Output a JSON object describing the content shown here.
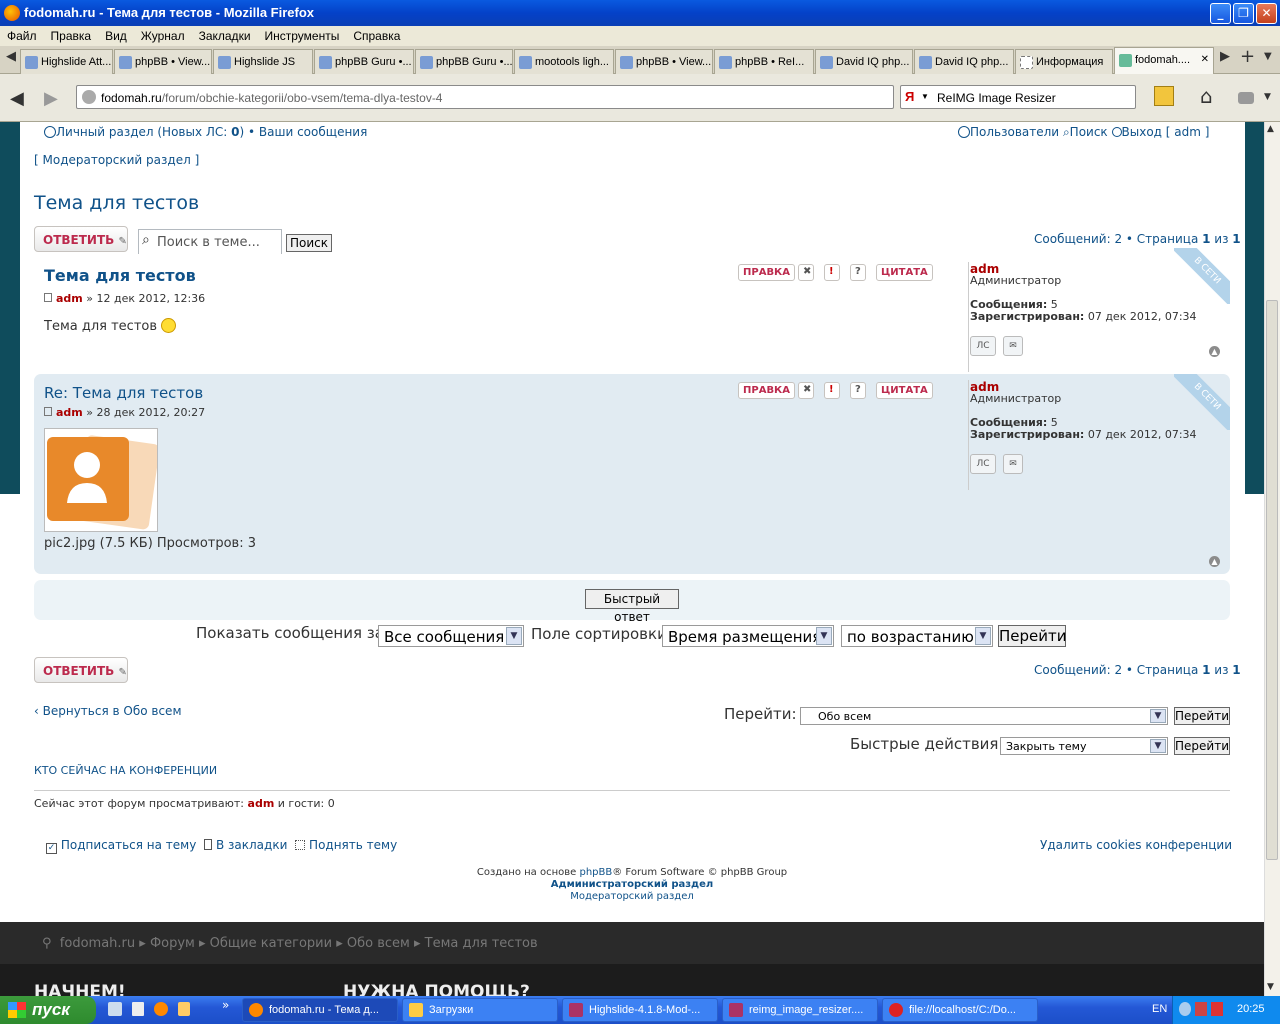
{
  "window": {
    "title": "fodomah.ru - Тема для тестов - Mozilla Firefox",
    "btn_min": "_",
    "btn_max": "❐",
    "btn_close": "✕"
  },
  "menu": [
    "Файл",
    "Правка",
    "Вид",
    "Журнал",
    "Закладки",
    "Инструменты",
    "Справка"
  ],
  "tabs": [
    "Highslide Att...",
    "phpBB • View...",
    "Highslide JS",
    "phpBB Guru •...",
    "phpBB Guru •...",
    "mootools ligh...",
    "phpBB • View...",
    "phpBB • ReI...",
    "David IQ php...",
    "David IQ php...",
    "Информация",
    "fodomah...."
  ],
  "tab_close": "✕",
  "tab_new": "+",
  "url": {
    "domain": "fodomah.ru",
    "path": "/forum/obchie-kategorii/obo-vsem/tema-dlya-testov-4"
  },
  "search_engine": "ReIMG Image Resizer",
  "icons": {
    "back": "arrow-left-icon",
    "forward": "arrow-right-icon",
    "reload": "reload-icon",
    "home": "home-icon",
    "star": "star-icon"
  },
  "glyphs": {
    "back": "◀",
    "forward": "▶",
    "star": "☆",
    "reload": "↻",
    "search": "⌕",
    "home": "⌂",
    "dropdown": "▼",
    "to_top": "▲",
    "breadcrumb_pin": "⚲"
  },
  "header": {
    "private": "Личный раздел (Новых ЛС: ",
    "private_count": "0",
    "private_end": ")",
    "sep": " • ",
    "my_posts": "Ваши сообщения",
    "users": "Пользователи",
    "search": "Поиск",
    "logout": "Выход [ adm ]",
    "moderator": "[ Модераторский раздел ]"
  },
  "topic_title": "Тема для тестов",
  "reply_label": "ОТВЕТИТЬ",
  "search_placeholder": "Поиск в теме...",
  "search_btn": "Поиск",
  "pagination": {
    "text": "Сообщений: 2 • Страница ",
    "page": "1",
    "of": " из ",
    "total": "1"
  },
  "post_buttons": {
    "edit": "ПРАВКА",
    "delete": "✖",
    "report": "!",
    "info": "?",
    "quote": "ЦИТАТА"
  },
  "posts": [
    {
      "title": "Тема для тестов",
      "author": "adm",
      "date": " » 12 дек 2012, 12:36",
      "body": "Тема для тестов",
      "user": "adm",
      "rank": "Администратор",
      "count_label": "Сообщения:",
      "count": " 5",
      "reg_label": "Зарегистрирован:",
      "reg": " 07 дек 2012, 07:34",
      "online": "В СЕТИ",
      "pm": "ЛС"
    },
    {
      "title": "Re: Тема для тестов",
      "author": "adm",
      "date": " » 28 дек 2012, 20:27",
      "attachment": "pic2.jpg (7.5 КБ) Просмотров: 3",
      "user": "adm",
      "rank": "Администратор",
      "count_label": "Сообщения:",
      "count": " 5",
      "reg_label": "Зарегистрирован:",
      "reg": " 07 дек 2012, 07:34",
      "online": "В СЕТИ",
      "pm": "ЛС"
    }
  ],
  "quick_reply": "Быстрый ответ",
  "sort": {
    "show_label": "Показать сообщения за:",
    "show_value": "Все сообщения",
    "field_label": "Поле сортировки",
    "field_value": "Время размещения",
    "dir_value": "по возрастанию",
    "go": "Перейти"
  },
  "back_link": "Вернуться в Обо всем",
  "jump": {
    "label": "Перейти:",
    "value": "Обо всем",
    "go": "Перейти"
  },
  "quick_actions": {
    "label": "Быстрые действия:",
    "value": "Закрыть тему",
    "go": "Перейти"
  },
  "who_online": "КТО СЕЙЧАС НА КОНФЕРЕНЦИИ",
  "viewing": {
    "text": "Сейчас этот форум просматривают: ",
    "user": "adm",
    "rest": " и гости: 0"
  },
  "options": {
    "subscribe": "Подписаться на тему",
    "bookmark": "В закладки",
    "bump": "Поднять тему"
  },
  "delete_cookies": "Удалить cookies конференции",
  "credits": {
    "pre": "Создано на основе ",
    "phpbb": "phpBB",
    "post": "® Forum Software © phpBB Group",
    "admin": "Администраторский раздел",
    "mod": "Модераторский раздел"
  },
  "breadcrumbs": [
    "fodomah.ru",
    "Форум",
    "Общие категории",
    "Обо всем",
    "Тема для тестов"
  ],
  "breadcrumb_sep": "▸",
  "footer": {
    "col1": "НАЧНЕМ!",
    "col2": "НУЖНА ПОМОЩЬ?"
  },
  "taskbar": {
    "start": "пуск",
    "more": "»",
    "tasks": [
      "fodomah.ru - Тема д...",
      "Загрузки",
      "Highslide-4.1.8-Mod-...",
      "reimg_image_resizer....",
      "file://localhost/C:/Do..."
    ],
    "lang": "EN",
    "clock": "20:25"
  }
}
